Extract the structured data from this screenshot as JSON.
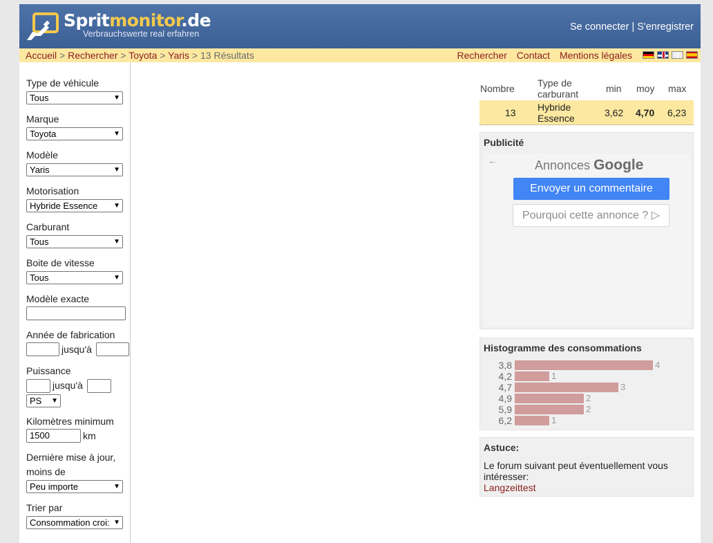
{
  "header": {
    "logo_main": "Sprit",
    "logo_accent": "monitor",
    "logo_tld": ".de",
    "tagline": "Verbrauchswerte real erfahren",
    "login_label": "Se connecter",
    "separator": "|",
    "register_label": "S'enregistrer"
  },
  "breadcrumb": {
    "home": "Accueil",
    "search": "Rechercher",
    "brand": "Toyota",
    "model": "Yaris",
    "results": "13 Résultats",
    "sep": ">"
  },
  "nav": {
    "search": "Rechercher",
    "contact": "Contact",
    "legal": "Mentions légales",
    "flags": [
      "flag-de-icon",
      "flag-gb-icon",
      "flag-fr-icon",
      "flag-es-icon"
    ]
  },
  "filters": {
    "vehicle_type": {
      "label": "Type de véhicule",
      "value": "Tous"
    },
    "brand": {
      "label": "Marque",
      "value": "Toyota"
    },
    "model": {
      "label": "Modèle",
      "value": "Yaris"
    },
    "engine": {
      "label": "Motorisation",
      "value": "Hybride Essence"
    },
    "fuel": {
      "label": "Carburant",
      "value": "Tous"
    },
    "gearbox": {
      "label": "Boite de vitesse",
      "value": "Tous"
    },
    "exact_model": {
      "label": "Modèle exacte",
      "value": ""
    },
    "year": {
      "label": "Année de fabrication",
      "to_label": "jusqu'à",
      "from": "",
      "to": ""
    },
    "power": {
      "label": "Puissance",
      "to_label": "jusqu'à",
      "from": "",
      "to": "",
      "unit": "PS"
    },
    "min_km": {
      "label": "Kilomètres minimum",
      "value": "1500",
      "unit": "km"
    },
    "last_update": {
      "label_line1": "Dernière mise à jour,",
      "label_line2": "moins de",
      "value": "Peu importe"
    },
    "sort": {
      "label": "Trier par",
      "value": "Consommation croi:"
    }
  },
  "results_table": {
    "headers": {
      "count": "Nombre",
      "fuel_type_1": "Type de",
      "fuel_type_2": "carburant",
      "min": "min",
      "avg": "moy",
      "max": "max"
    },
    "row": {
      "count": "13",
      "fuel_1": "Hybride",
      "fuel_2": "Essence",
      "min": "3,62",
      "avg": "4,70",
      "max": "6,23"
    }
  },
  "ad": {
    "title": "Publicité",
    "back_icon": "arrow-left-icon",
    "annonces": "Annonces",
    "google": "Google",
    "feedback_button": "Envoyer un commentaire",
    "why_button": "Pourquoi cette annonce ?",
    "why_icon": "play-outline-icon"
  },
  "histogram": {
    "title": "Histogramme des consommations",
    "color": "#d09c9c"
  },
  "chart_data": {
    "type": "bar",
    "orientation": "horizontal",
    "title": "Histogramme des consommations",
    "categories": [
      "3,8",
      "4,2",
      "4,7",
      "4,9",
      "5,9",
      "6,2"
    ],
    "values": [
      4,
      1,
      3,
      2,
      2,
      1
    ]
  },
  "tip": {
    "title": "Astuce:",
    "text": "Le forum suivant peut éventuellement vous intéresser:",
    "link": "Langzeittest"
  },
  "colors": {
    "header": "#4a6fa5",
    "navbar": "#fce8a0",
    "link": "#8a1d1d",
    "accent": "#f2c94c"
  }
}
